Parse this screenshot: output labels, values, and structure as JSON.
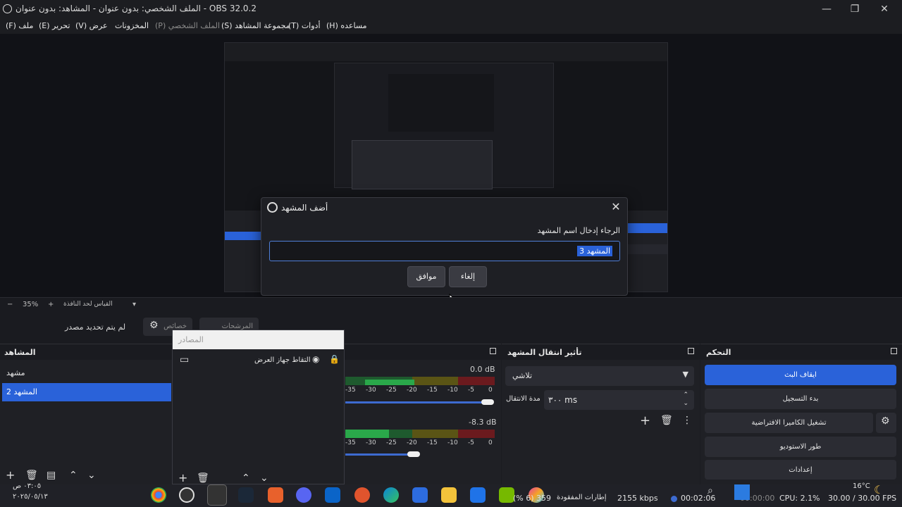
{
  "window": {
    "title": "OBS 32.0.2 - الملف الشخصي: بدون عنوان - المشاهد: بدون عنوان",
    "minimize": "—",
    "maximize": "❐",
    "close": "✕"
  },
  "menu": [
    {
      "label": "ملف (F)"
    },
    {
      "label": "تحرير (E)"
    },
    {
      "label": "عرض (V)"
    },
    {
      "label": "المخزونات"
    },
    {
      "label": "الملف الشخصي (P)"
    },
    {
      "label": "مجموعة المشاهد (S)"
    },
    {
      "label": "أدوات (T)"
    },
    {
      "label": "مساعده (H)"
    }
  ],
  "dialog": {
    "title": "أضف المشهد",
    "prompt": "الرجاء إدخال اسم المشهد",
    "input_value": "المشهد 3",
    "ok_label": "موافق",
    "cancel_label": "إلغاء",
    "close": "✕"
  },
  "zoom": {
    "value": "35%",
    "minus": "−",
    "plus": "+",
    "fit_label": "القياس لحد النافذة"
  },
  "source_toolbar": {
    "no_source": "لم يتم تحديد مصدر",
    "properties": "خصائص",
    "filters": "المرشحات"
  },
  "scenes": {
    "title": "المشاهد",
    "items": [
      "مشهد",
      "المشهد 2"
    ],
    "selected_index": 1
  },
  "sources": {
    "title": "المصادر",
    "items": [
      {
        "label": "التقاط جهاز العرض"
      }
    ]
  },
  "mixer": {
    "channels": [
      {
        "db": "0.0 dB",
        "level": 0.35
      },
      {
        "db": "-8.3 dB",
        "level": 0.3
      }
    ],
    "ticks": [
      "-35",
      "-30",
      "-25",
      "-20",
      "-15",
      "-10",
      "-5",
      "0"
    ]
  },
  "transitions": {
    "title": "تأثير انتقال المشهد",
    "selected": "تلاشي",
    "duration_label": "مدة الانتقال",
    "duration_value": "٣٠٠ ms"
  },
  "controls": {
    "title": "التحكم",
    "buttons": [
      "ايقاف البث",
      "بدء التسجيل",
      "تشغيل الكاميرا الافتراضية",
      "طور الاستوديو",
      "إعدادات"
    ]
  },
  "status": {
    "time1": "٠٣:٠٥ ص",
    "date": "٢٠٢٥/٠٥/١٣",
    "bitrate": "2155 kbps",
    "stream_time": "00:02:06",
    "rec_time": "00:00:00",
    "cpu": "CPU: 2.1%",
    "fps": "30.00 / 30.00 FPS",
    "weather": "16°C",
    "dropped": "(% 6) 359",
    "dropped_label": "إطارات المفقودة"
  },
  "colors": {
    "accent": "#2a62d9",
    "meter_green": "#2aa84a",
    "meter_yellow": "#b7a21e",
    "meter_red": "#a1262b"
  }
}
